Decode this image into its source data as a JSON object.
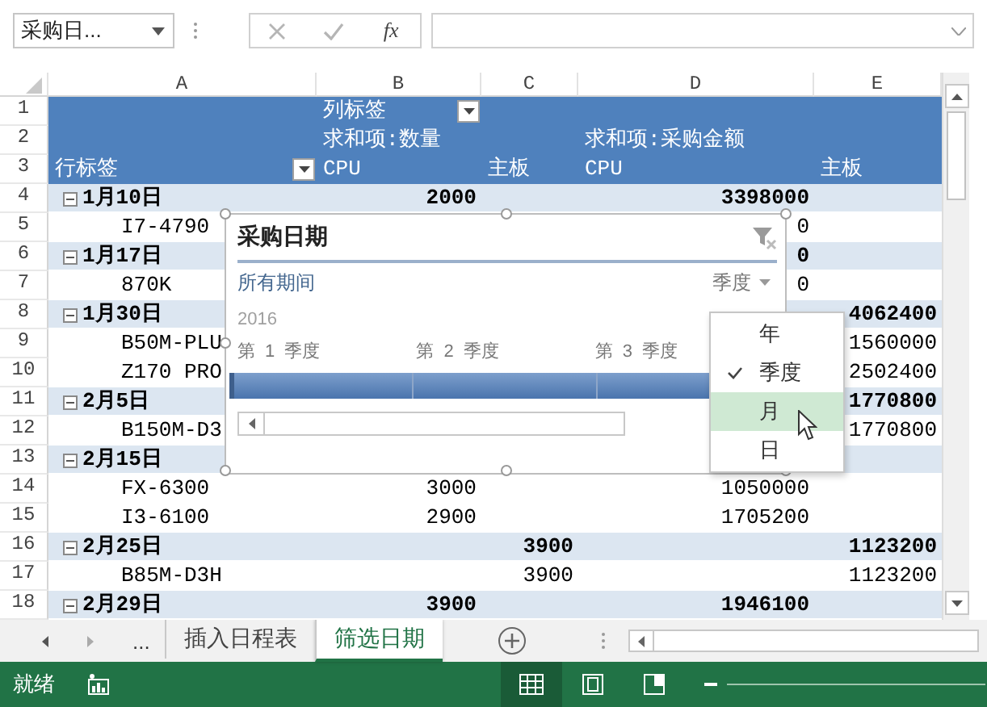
{
  "name_box": {
    "value": "采购日..."
  },
  "formula_bar": {
    "fx": "fx"
  },
  "columns": [
    "A",
    "B",
    "C",
    "D",
    "E"
  ],
  "rows": [
    {
      "number": "1",
      "kind": "header",
      "b": "列标签",
      "b_button": true
    },
    {
      "number": "2",
      "kind": "header",
      "b": "求和项:数量",
      "d": "求和项:采购金额"
    },
    {
      "number": "3",
      "kind": "header",
      "a": "行标签",
      "a_button": true,
      "b": "CPU",
      "c": "主板",
      "d": "CPU",
      "e": "主板"
    },
    {
      "number": "4",
      "kind": "group",
      "expanded": true,
      "a": "1月10日",
      "b": "2000",
      "d": "3398000"
    },
    {
      "number": "5",
      "kind": "item",
      "a": "I7-4790",
      "d": "0"
    },
    {
      "number": "6",
      "kind": "group",
      "expanded": true,
      "a": "1月17日",
      "d": "0"
    },
    {
      "number": "7",
      "kind": "item",
      "a": "870K",
      "d": "0"
    },
    {
      "number": "8",
      "kind": "group",
      "expanded": true,
      "a": "1月30日",
      "e": "4062400"
    },
    {
      "number": "9",
      "kind": "item",
      "a": "B50M-PLU",
      "e": "1560000"
    },
    {
      "number": "10",
      "kind": "item",
      "a": "Z170 PRO",
      "e": "2502400"
    },
    {
      "number": "11",
      "kind": "group",
      "expanded": true,
      "a": "2月5日",
      "e": "1770800"
    },
    {
      "number": "12",
      "kind": "item",
      "a": "B150M-D3",
      "e": "1770800"
    },
    {
      "number": "13",
      "kind": "group",
      "expanded": true,
      "a": "2月15日"
    },
    {
      "number": "14",
      "kind": "item",
      "a": "FX-6300",
      "b": "3000",
      "d": "1050000"
    },
    {
      "number": "15",
      "kind": "item",
      "a": "I3-6100",
      "b": "2900",
      "d": "1705200"
    },
    {
      "number": "16",
      "kind": "group",
      "expanded": true,
      "a": "2月25日",
      "c": "3900",
      "e": "1123200"
    },
    {
      "number": "17",
      "kind": "item",
      "a": "B85M-D3H",
      "c": "3900",
      "e": "1123200"
    },
    {
      "number": "18",
      "kind": "group",
      "expanded": true,
      "a": "2月29日",
      "b": "3900",
      "d": "1946100"
    }
  ],
  "slicer": {
    "title": "采购日期",
    "all_periods": "所有期间",
    "level": "季度",
    "year": "2016",
    "periods": [
      {
        "label": "第 1 季度",
        "selected": true
      },
      {
        "label": "第 2 季度",
        "selected": true
      },
      {
        "label": "第 3 季度",
        "selected": true
      }
    ],
    "level_menu": [
      {
        "label": "年",
        "checked": false,
        "selected": false
      },
      {
        "label": "季度",
        "checked": true,
        "selected": false
      },
      {
        "label": "月",
        "checked": false,
        "selected": true
      },
      {
        "label": "日",
        "checked": false,
        "selected": false
      }
    ]
  },
  "sheet_tabs": {
    "overflow": "...",
    "tabs": [
      {
        "label": "插入日程表",
        "selected": false
      },
      {
        "label": "筛选日期",
        "selected": true
      }
    ]
  },
  "status_bar": {
    "text": "就绪",
    "views": [
      {
        "kind": "normal",
        "selected": true
      },
      {
        "kind": "page-layout",
        "selected": false
      },
      {
        "kind": "page-break",
        "selected": false
      }
    ]
  }
}
